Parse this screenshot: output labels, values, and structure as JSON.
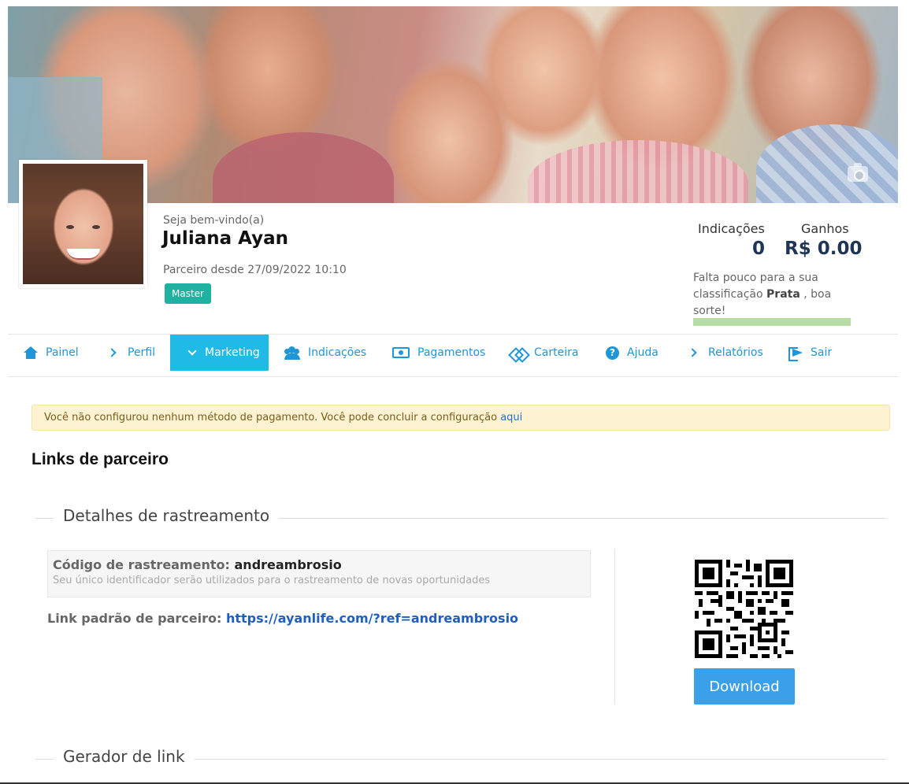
{
  "profile": {
    "welcome": "Seja bem-vindo(a)",
    "name": "Juliana Ayan",
    "partner_since": "Parceiro desde 27/09/2022 10:10",
    "badge": "Master"
  },
  "stats": {
    "referrals_label": "Indicações",
    "referrals_value": "0",
    "earnings_label": "Ganhos",
    "earnings_value": "R$ 0.00",
    "rank_prefix": "Falta pouco para a sua classificação",
    "rank_name": "Prata",
    "rank_suffix": ", boa sorte!",
    "progress_fraction": 0.0
  },
  "nav": {
    "items": [
      {
        "label": "Painel",
        "icon": "home-icon"
      },
      {
        "label": "Perfil",
        "icon": "chevron-right-icon"
      },
      {
        "label": "Marketing",
        "icon": "chevron-down-icon",
        "active": true
      },
      {
        "label": "Indicações",
        "icon": "users-icon"
      },
      {
        "label": "Pagamentos",
        "icon": "money-icon"
      },
      {
        "label": "Carteira",
        "icon": "wallet-icon"
      },
      {
        "label": "Ajuda",
        "icon": "help-icon"
      },
      {
        "label": "Relatórios",
        "icon": "chevron-right-icon"
      },
      {
        "label": "Sair",
        "icon": "exit-icon"
      }
    ]
  },
  "alert": {
    "text": "Você não configurou nenhum método de pagamento. Você pode concluir a configuração",
    "link": "aqui"
  },
  "page": {
    "title": "Links de parceiro"
  },
  "tracking": {
    "legend": "Detalhes de rastreamento",
    "code_label": "Código de rastreamento:",
    "code_value": "andreambrosio",
    "help": "Seu único identificador serão utilizados para o rastreamento de novas oportunidades",
    "link_label": "Link padrão de parceiro:",
    "link_value": "https://ayanlife.com/?ref=andreambrosio",
    "download_label": "Download"
  },
  "generator": {
    "legend": "Gerador de link"
  },
  "colors": {
    "accent": "#1fbbe6",
    "link": "#1f96d8",
    "badge": "#20b2a0",
    "button": "#3ba0ea"
  }
}
